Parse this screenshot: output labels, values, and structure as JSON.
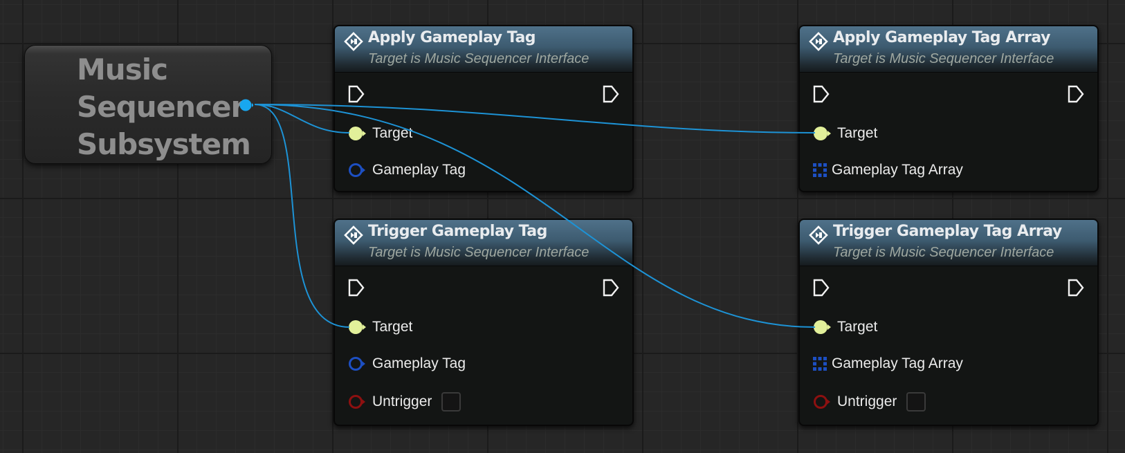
{
  "getter_node": {
    "title_lines": [
      "Music",
      "Sequencer",
      "Subsystem"
    ],
    "output_pin_icon": "object-reference-pin-icon"
  },
  "nodes": [
    {
      "title": "Apply Gameplay Tag",
      "subtitle": "Target is Music Sequencer Interface",
      "pins": {
        "target": "Target",
        "tag": "Gameplay Tag"
      }
    },
    {
      "title": "Apply Gameplay Tag Array",
      "subtitle": "Target is Music Sequencer Interface",
      "pins": {
        "target": "Target",
        "tag": "Gameplay Tag Array"
      }
    },
    {
      "title": "Trigger Gameplay Tag",
      "subtitle": "Target is Music Sequencer Interface",
      "pins": {
        "target": "Target",
        "tag": "Gameplay Tag",
        "untrigger": "Untrigger"
      }
    },
    {
      "title": "Trigger Gameplay Tag Array",
      "subtitle": "Target is Music Sequencer Interface",
      "pins": {
        "target": "Target",
        "tag": "Gameplay Tag Array",
        "untrigger": "Untrigger"
      }
    }
  ],
  "colors": {
    "wire": "#1d93d6",
    "object_pin": "#18a7f0",
    "target_pin": "#e2f09a",
    "struct_pin": "#1d4fc2",
    "bool_pin": "#8d1010",
    "header": "#4f7189"
  }
}
